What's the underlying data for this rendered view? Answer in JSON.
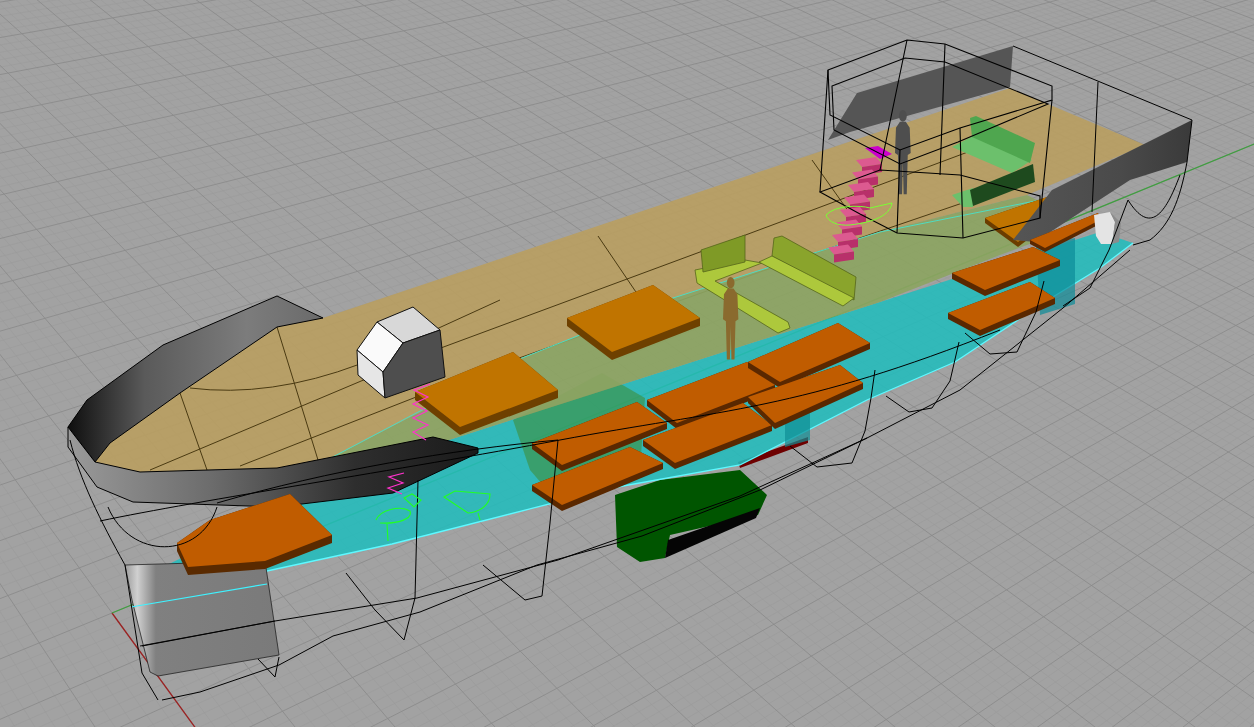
{
  "viewport": {
    "grid": true,
    "world_axes": true
  }
}
